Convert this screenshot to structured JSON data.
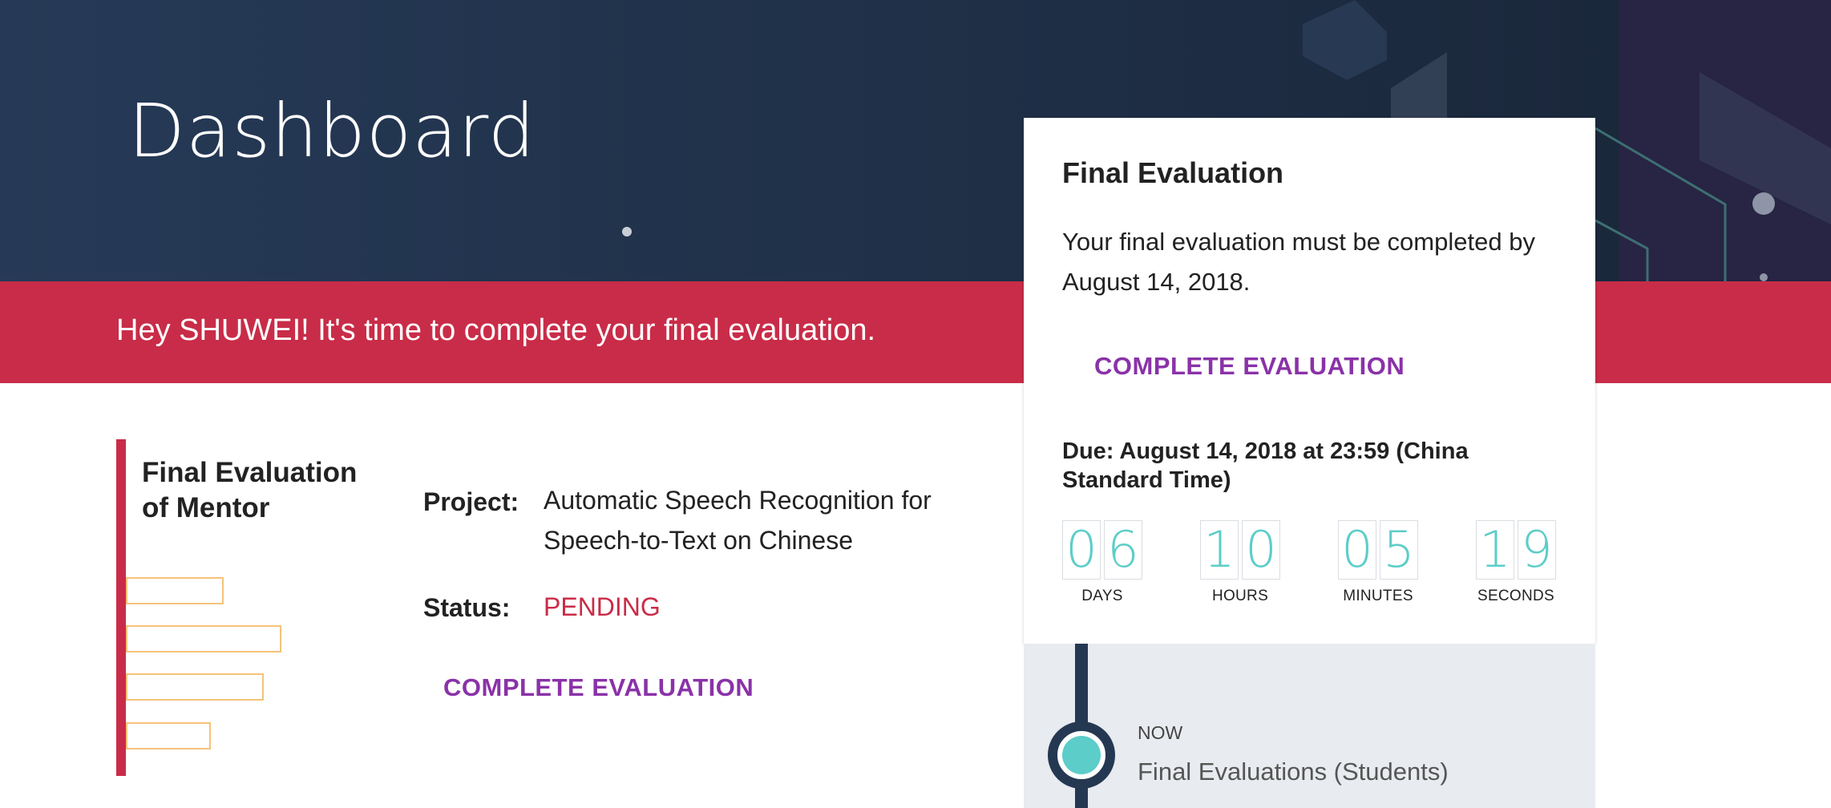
{
  "header": {
    "title": "Dashboard"
  },
  "alert": {
    "text": "Hey SHUWEI! It's time to complete your final evaluation."
  },
  "evaluation_item": {
    "title": "Final Evaluation of Mentor",
    "project_label": "Project:",
    "project_value": "Automatic Speech Recognition for Speech-to-Text on Chinese",
    "status_label": "Status:",
    "status_value": "PENDING",
    "action_label": "COMPLETE EVALUATION"
  },
  "side_card": {
    "title": "Final Evaluation",
    "description": "Your final evaluation must be completed by August 14, 2018.",
    "action_label": "COMPLETE EVALUATION",
    "due_text": "Due: August 14, 2018 at 23:59 (China Standard Time)",
    "countdown": [
      {
        "label": "DAYS",
        "d1": "0",
        "d2": "6"
      },
      {
        "label": "HOURS",
        "d1": "1",
        "d2": "0"
      },
      {
        "label": "MINUTES",
        "d1": "0",
        "d2": "5"
      },
      {
        "label": "SECONDS",
        "d1": "1",
        "d2": "9"
      }
    ]
  },
  "timeline": {
    "now_label": "NOW",
    "item_title": "Final Evaluations (Students)"
  },
  "colors": {
    "header_bg": "#203149",
    "alert_bg": "#c92c48",
    "accent_purple": "#8a32a8",
    "countdown_teal": "#5ccdc9",
    "timeline_dark": "#253852"
  }
}
